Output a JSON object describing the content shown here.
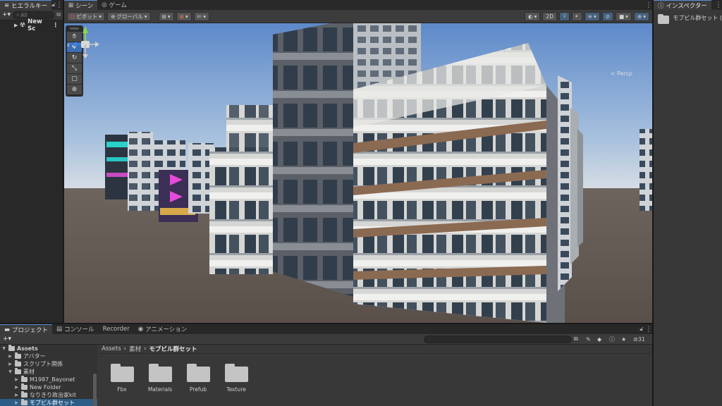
{
  "hierarchy": {
    "tab_label": "ヒエラルキー",
    "search_placeholder": "All",
    "add_label": "+▾",
    "items": [
      {
        "label": "New Sc"
      }
    ]
  },
  "scene": {
    "tabs": [
      {
        "label": "シーン",
        "active": true
      },
      {
        "label": "ゲーム",
        "active": false
      }
    ],
    "toolbar": {
      "pivot_label": "ピボット",
      "global_label": "グローバル",
      "two_d_label": "2D"
    },
    "persp_label": "< Persp"
  },
  "project": {
    "tabs": [
      {
        "label": "プロジェクト",
        "active": true
      },
      {
        "label": "コンソール",
        "active": false
      },
      {
        "label": "Recorder",
        "active": false
      },
      {
        "label": "アニメーション",
        "active": false
      }
    ],
    "add_label": "+▾",
    "hidden_count": "31",
    "tree": [
      {
        "label": "Assets",
        "indent": 0,
        "expanded": true,
        "bold": true,
        "selected": false
      },
      {
        "label": "アバター",
        "indent": 1,
        "expanded": false,
        "bold": false,
        "selected": false
      },
      {
        "label": "スクリプト関係",
        "indent": 1,
        "expanded": false,
        "bold": false,
        "selected": false
      },
      {
        "label": "素材",
        "indent": 1,
        "expanded": true,
        "bold": false,
        "selected": false
      },
      {
        "label": "M1987_Bayonet",
        "indent": 2,
        "expanded": false,
        "bold": false,
        "selected": false
      },
      {
        "label": "New Folder",
        "indent": 2,
        "expanded": false,
        "bold": false,
        "selected": false
      },
      {
        "label": "なりきり政治家kit",
        "indent": 2,
        "expanded": false,
        "bold": false,
        "selected": false
      },
      {
        "label": "モブビル群セット",
        "indent": 2,
        "expanded": false,
        "bold": false,
        "selected": true
      }
    ],
    "breadcrumb": [
      {
        "label": "Assets",
        "current": false
      },
      {
        "label": "素材",
        "current": false
      },
      {
        "label": "モブビル群セット",
        "current": true
      }
    ],
    "assets": [
      {
        "label": "Fbx"
      },
      {
        "label": "Materials"
      },
      {
        "label": "Prefub"
      },
      {
        "label": "Texture"
      }
    ]
  },
  "inspector": {
    "tab_label": "インスペクター",
    "title": "モブビル群セット (",
    "icon": "folder-icon"
  },
  "colors": {
    "panel_bg": "#383838",
    "dark_bg": "#282828",
    "selection": "#2c5d87",
    "accent": "#3d6fb3"
  }
}
